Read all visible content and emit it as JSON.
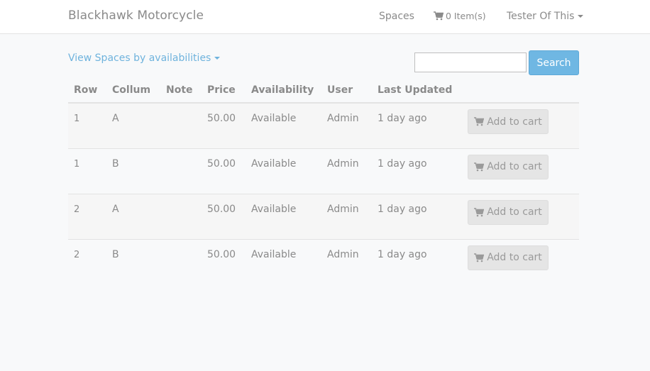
{
  "navbar": {
    "brand": "Blackhawk Motorcycle",
    "spaces_label": "Spaces",
    "cart_label": "0 Item(s)",
    "user_label": "Tester Of This"
  },
  "filter": {
    "label": "View Spaces by availabilities"
  },
  "search": {
    "value": "",
    "button_label": "Search"
  },
  "table": {
    "headers": [
      "Row",
      "Collum",
      "Note",
      "Price",
      "Availability",
      "User",
      "Last Updated",
      ""
    ],
    "rows": [
      {
        "row": "1",
        "collum": "A",
        "note": "",
        "price": "50.00",
        "availability": "Available",
        "user": "Admin",
        "updated": "1 day ago",
        "action": "Add to cart"
      },
      {
        "row": "1",
        "collum": "B",
        "note": "",
        "price": "50.00",
        "availability": "Available",
        "user": "Admin",
        "updated": "1 day ago",
        "action": "Add to cart"
      },
      {
        "row": "2",
        "collum": "A",
        "note": "",
        "price": "50.00",
        "availability": "Available",
        "user": "Admin",
        "updated": "1 day ago",
        "action": "Add to cart"
      },
      {
        "row": "2",
        "collum": "B",
        "note": "",
        "price": "50.00",
        "availability": "Available",
        "user": "Admin",
        "updated": "1 day ago",
        "action": "Add to cart"
      }
    ]
  },
  "icons": {
    "cart": "shopping-cart-icon",
    "caret": "caret-down-icon"
  },
  "colors": {
    "link": "#6fb3dd",
    "button_primary": "#6fb7e3",
    "text": "#8a8a8a",
    "background": "#f8f9fa"
  }
}
